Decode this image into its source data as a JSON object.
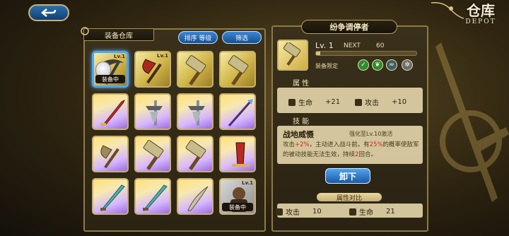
{
  "header": {
    "title_cn": "仓库",
    "title_en": "DEPOT"
  },
  "inventory": {
    "title": "装备仓库",
    "sort_label": "排序 等级",
    "filter_label": "筛选",
    "slots": [
      {
        "kind": "gold",
        "weapon": "scythe",
        "lv": "Lv.1",
        "tag": "装备中",
        "selected": true,
        "avatar": true
      },
      {
        "kind": "gold",
        "weapon": "axe-red",
        "lv": "Lv.1"
      },
      {
        "kind": "gold",
        "weapon": "hammer",
        "lv": ""
      },
      {
        "kind": "gold",
        "weapon": "hammer",
        "lv": ""
      },
      {
        "kind": "purple",
        "weapon": "blade-red",
        "lv": ""
      },
      {
        "kind": "purple",
        "weapon": "twin-blade",
        "lv": ""
      },
      {
        "kind": "purple",
        "weapon": "twin-blade",
        "lv": ""
      },
      {
        "kind": "purple",
        "weapon": "spear-purple",
        "lv": ""
      },
      {
        "kind": "purple",
        "weapon": "axe",
        "lv": ""
      },
      {
        "kind": "purple",
        "weapon": "hammer",
        "lv": ""
      },
      {
        "kind": "purple",
        "weapon": "hammer",
        "lv": ""
      },
      {
        "kind": "purple",
        "weapon": "greatsword-red",
        "lv": ""
      },
      {
        "kind": "purple",
        "weapon": "sword-teal",
        "lv": ""
      },
      {
        "kind": "purple",
        "weapon": "sword-teal",
        "lv": ""
      },
      {
        "kind": "purple",
        "weapon": "sword-curved",
        "lv": ""
      },
      {
        "kind": "grey",
        "weapon": "avatar",
        "lv": "Lv.1",
        "tag": "装备中"
      }
    ]
  },
  "detail": {
    "name": "纷争调停者",
    "level": "Lv. 1",
    "next_label": "NEXT",
    "next_value": "60",
    "xp_fraction": 0.04,
    "limit_label": "装备限定",
    "attr_title": "属 性",
    "stats": [
      {
        "name": "生命",
        "value": "+21"
      },
      {
        "name": "攻击",
        "value": "+10"
      }
    ],
    "skill_title": "技 能",
    "skill_name": "战地威慑",
    "skill_req": "强化至Lv.10激活",
    "skill_desc_1": "攻击",
    "skill_desc_2": "+2%",
    "skill_desc_3": "，主动进入战斗前，有",
    "skill_desc_4": "25%",
    "skill_desc_5": "的概率使敌军的被动技能无法生效，持续",
    "skill_desc_6": "2",
    "skill_desc_7": "回合。",
    "unequip_label": "卸下",
    "compare_title": "属性对比",
    "compare": [
      {
        "name": "攻击",
        "value": "10"
      },
      {
        "name": "生命",
        "value": "21"
      }
    ]
  },
  "colors": {
    "accent_blue": "#2b6fb0",
    "gold": "#c9b06b",
    "red_text": "#d12a1f"
  }
}
